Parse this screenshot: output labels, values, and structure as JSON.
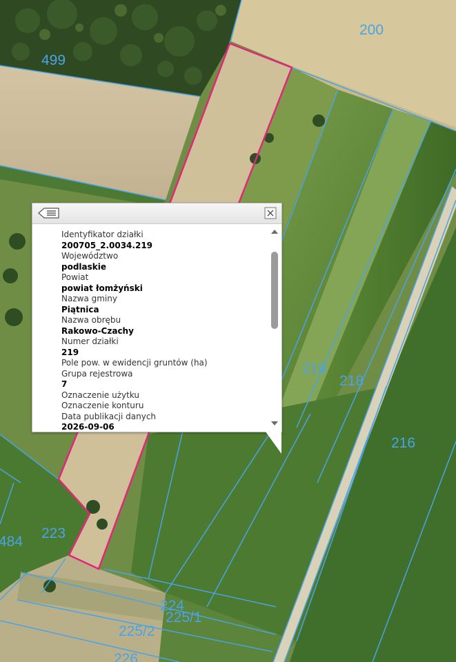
{
  "map": {
    "parcel_labels": [
      "200",
      "499",
      "219",
      "218",
      "216",
      "223",
      "484",
      "224",
      "225/1",
      "225/2",
      "226"
    ],
    "colors": {
      "parcel_boundary": "#4aa3e6",
      "selected_parcel": "#e0287a"
    }
  },
  "popup": {
    "back_icon": "list-back-icon",
    "close_icon": "close-icon",
    "fields": [
      {
        "label": "Identyfikator działki",
        "value": "200705_2.0034.219"
      },
      {
        "label": "Województwo",
        "value": "podlaskie"
      },
      {
        "label": "Powiat",
        "value": "powiat łomżyński"
      },
      {
        "label": "Nazwa gminy",
        "value": "Piątnica"
      },
      {
        "label": "Nazwa obrębu",
        "value": "Rakowo-Czachy"
      },
      {
        "label": "Numer działki",
        "value": "219"
      },
      {
        "label": "Pole pow. w ewidencji gruntów (ha)",
        "value": ""
      },
      {
        "label": "Grupa rejestrowa",
        "value": "7"
      },
      {
        "label": "Oznaczenie użytku",
        "value": ""
      },
      {
        "label": "Oznaczenie konturu",
        "value": ""
      },
      {
        "label": "Data publikacji danych",
        "value": "2026-09-06"
      }
    ]
  }
}
